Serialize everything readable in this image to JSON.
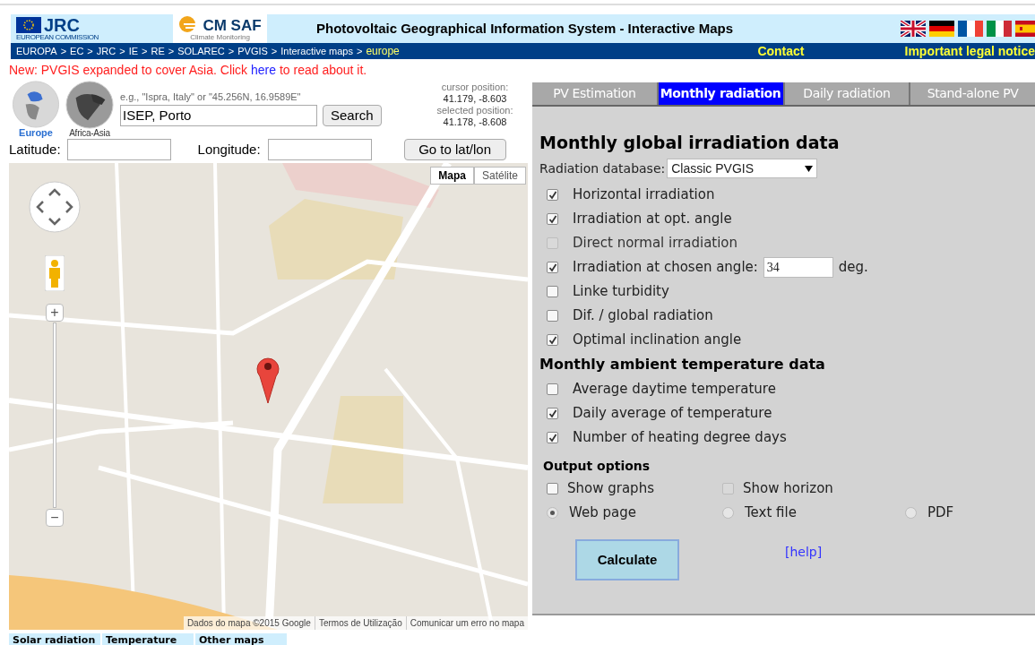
{
  "header": {
    "jrc": "JRC",
    "jrc_sub": "EUROPEAN COMMISSION",
    "cmsaf": "CM SAF",
    "cmsaf_sub": "Climate Monitoring",
    "title": "Photovoltaic Geographical Information System - Interactive Maps"
  },
  "breadcrumb": {
    "separator": ">",
    "items": [
      {
        "label": "EUROPA",
        "selected": false
      },
      {
        "label": "EC",
        "selected": false
      },
      {
        "label": "JRC",
        "selected": false
      },
      {
        "label": "IE",
        "selected": false
      },
      {
        "label": "RE",
        "selected": false
      },
      {
        "label": "SOLAREC",
        "selected": false
      },
      {
        "label": "PVGIS",
        "selected": false
      },
      {
        "label": "Interactive maps",
        "selected": false
      },
      {
        "label": "europe",
        "selected": true
      }
    ]
  },
  "nav_links": [
    "Contact",
    "Important legal notice"
  ],
  "notice": {
    "before": "New: PVGIS expanded to cover Asia. Click ",
    "link": "here",
    "after": " to read about it."
  },
  "regions": [
    {
      "label": "Europe",
      "selected": true
    },
    {
      "label": "Africa-Asia",
      "selected": false
    }
  ],
  "search": {
    "hint": "e.g., \"Ispra, Italy\" or \"45.256N, 16.9589E\"",
    "value": "ISEP, Porto",
    "button": "Search"
  },
  "positions": [
    {
      "label": "cursor position:",
      "value": "41.179, -8.603"
    },
    {
      "label": "selected position:",
      "value": "41.178, -8.608"
    }
  ],
  "coords": {
    "latitude_label": "Latitude:",
    "longitude_label": "Longitude:",
    "button": "Go to lat/lon"
  },
  "map": {
    "types": [
      {
        "label": "Mapa",
        "selected": true
      },
      {
        "label": "Satélite",
        "selected": false
      }
    ],
    "zoom_in": "+",
    "zoom_out": "−",
    "attribution": [
      "Dados do mapa ©2015 Google",
      "Termos de Utilização",
      "Comunicar um erro no mapa"
    ]
  },
  "map_tabs": [
    "Solar radiation",
    "Temperature",
    "Other maps"
  ],
  "tabs": [
    {
      "label": "PV Estimation",
      "selected": false
    },
    {
      "label": "Monthly radiation",
      "selected": true
    },
    {
      "label": "Daily radiation",
      "selected": false
    },
    {
      "label": "Stand-alone PV",
      "selected": false
    }
  ],
  "heading": "Monthly global irradiation data",
  "database": {
    "label": "Radiation database:",
    "value": "Classic PVGIS"
  },
  "irradiation_options": [
    {
      "label": "Horizontal irradiation",
      "checked": true,
      "disabled": false
    },
    {
      "label": "Irradiation at opt. angle",
      "checked": true,
      "disabled": false
    },
    {
      "label": "Direct normal irradiation",
      "checked": false,
      "disabled": true
    },
    {
      "label": "Irradiation at chosen angle:",
      "checked": true,
      "disabled": false,
      "value": "34",
      "unit": "deg."
    },
    {
      "label": "Linke turbidity",
      "checked": false,
      "disabled": false
    },
    {
      "label": "Dif. / global radiation",
      "checked": false,
      "disabled": false
    },
    {
      "label": "Optimal inclination angle",
      "checked": true,
      "disabled": false
    }
  ],
  "temperature_heading": "Monthly ambient temperature data",
  "temperature_options": [
    {
      "label": "Average daytime temperature",
      "checked": false,
      "disabled": false
    },
    {
      "label": "Daily average of temperature",
      "checked": true,
      "disabled": false
    },
    {
      "label": "Number of heating degree days",
      "checked": true,
      "disabled": false
    }
  ],
  "output_heading": "Output options",
  "output_options": [
    {
      "kind": "checkbox",
      "label": "Show graphs",
      "checked": false,
      "disabled": false
    },
    {
      "kind": "checkbox",
      "label": "Show horizon",
      "checked": false,
      "disabled": true
    },
    {
      "kind": "spacer"
    },
    {
      "kind": "radio",
      "label": "Web page",
      "selected": true
    },
    {
      "kind": "radio",
      "label": "Text file",
      "selected": false
    },
    {
      "kind": "radio",
      "label": "PDF",
      "selected": false
    }
  ],
  "calculate": "Calculate",
  "help": "[help]"
}
